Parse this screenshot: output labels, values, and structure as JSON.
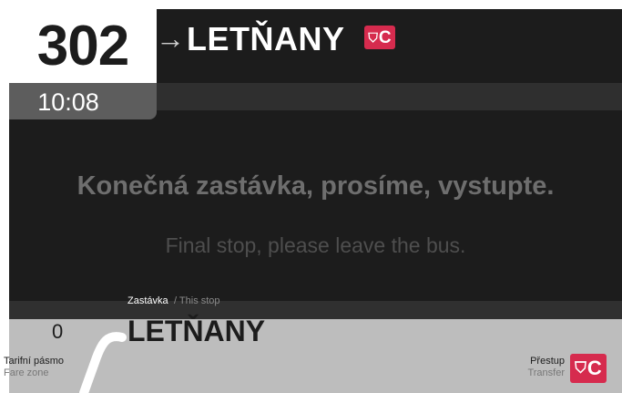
{
  "header": {
    "route_number": "302",
    "time": "10:08",
    "arrow_icon": "→",
    "destination": "LETŇANY",
    "metro_badge": {
      "symbol": "⛉",
      "letter": "C",
      "color": "#d62b4e"
    }
  },
  "message": {
    "cz": "Konečná zastávka, prosíme, vystupte.",
    "en": "Final stop, please leave the bus."
  },
  "stop": {
    "label_cz": "Zastávka",
    "label_en": "/ This stop",
    "name": "LETŇANY"
  },
  "fare_zone": {
    "value": "0",
    "label_cz": "Tarifní pásmo",
    "label_en": "Fare zone"
  },
  "transfer": {
    "label_cz": "Přestup",
    "label_en": "Transfer",
    "metro_badge": {
      "symbol": "⛉",
      "letter": "C",
      "color": "#d62b4e"
    }
  }
}
